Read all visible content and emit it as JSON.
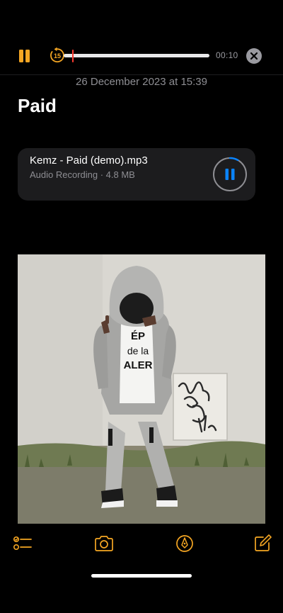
{
  "player": {
    "skip_back_seconds": "15",
    "elapsed": "00:10",
    "progress": 0.06
  },
  "note": {
    "date": "26 December 2023 at 15:39",
    "title": "Paid"
  },
  "attachment": {
    "filename": "Kemz - Paid (demo).mp3",
    "meta": "Audio Recording · 4.8 MB",
    "playback_progress": 0.08
  },
  "photo": {
    "shirt_text_line1": "ÉP",
    "shirt_text_line2": "de la",
    "shirt_text_line3": "ALER"
  },
  "toolbar": {
    "icons": [
      "checklist-icon",
      "camera-icon",
      "markup-icon",
      "compose-icon"
    ]
  },
  "colors": {
    "accent": "#f5a623",
    "background": "#000000",
    "card": "#1c1c1e",
    "secondary_text": "#8e8e93",
    "play_blue": "#0a84ff",
    "scrub_handle": "#ff3b30"
  }
}
